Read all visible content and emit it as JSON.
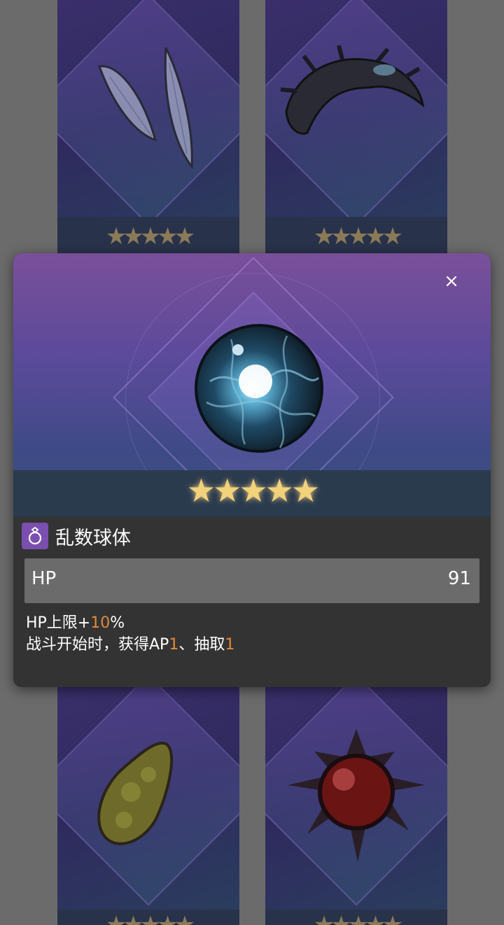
{
  "cards": [
    {
      "id": "wings",
      "stars": "★★★★★"
    },
    {
      "id": "crown",
      "stars": "★★★★★"
    },
    {
      "id": "egg",
      "stars": "★★★★★"
    },
    {
      "id": "red-orb",
      "stars": "★★★★★"
    }
  ],
  "modal": {
    "close_label": "×",
    "stars": "★★★★★",
    "item_name": "乱数球体",
    "item_icon": "ring-icon",
    "stat": {
      "label": "HP",
      "value": "91"
    },
    "effect_line1": {
      "prefix": "HP上限+",
      "value": "10",
      "suffix": "%"
    },
    "effect_line2": {
      "prefix": "战斗开始时，获得AP",
      "value1": "1",
      "middle": "、抽取",
      "value2": "1"
    }
  },
  "colors": {
    "highlight": "#e08a3a",
    "star_active": "#f2d27a",
    "icon_bg": "#7a4fb0"
  }
}
